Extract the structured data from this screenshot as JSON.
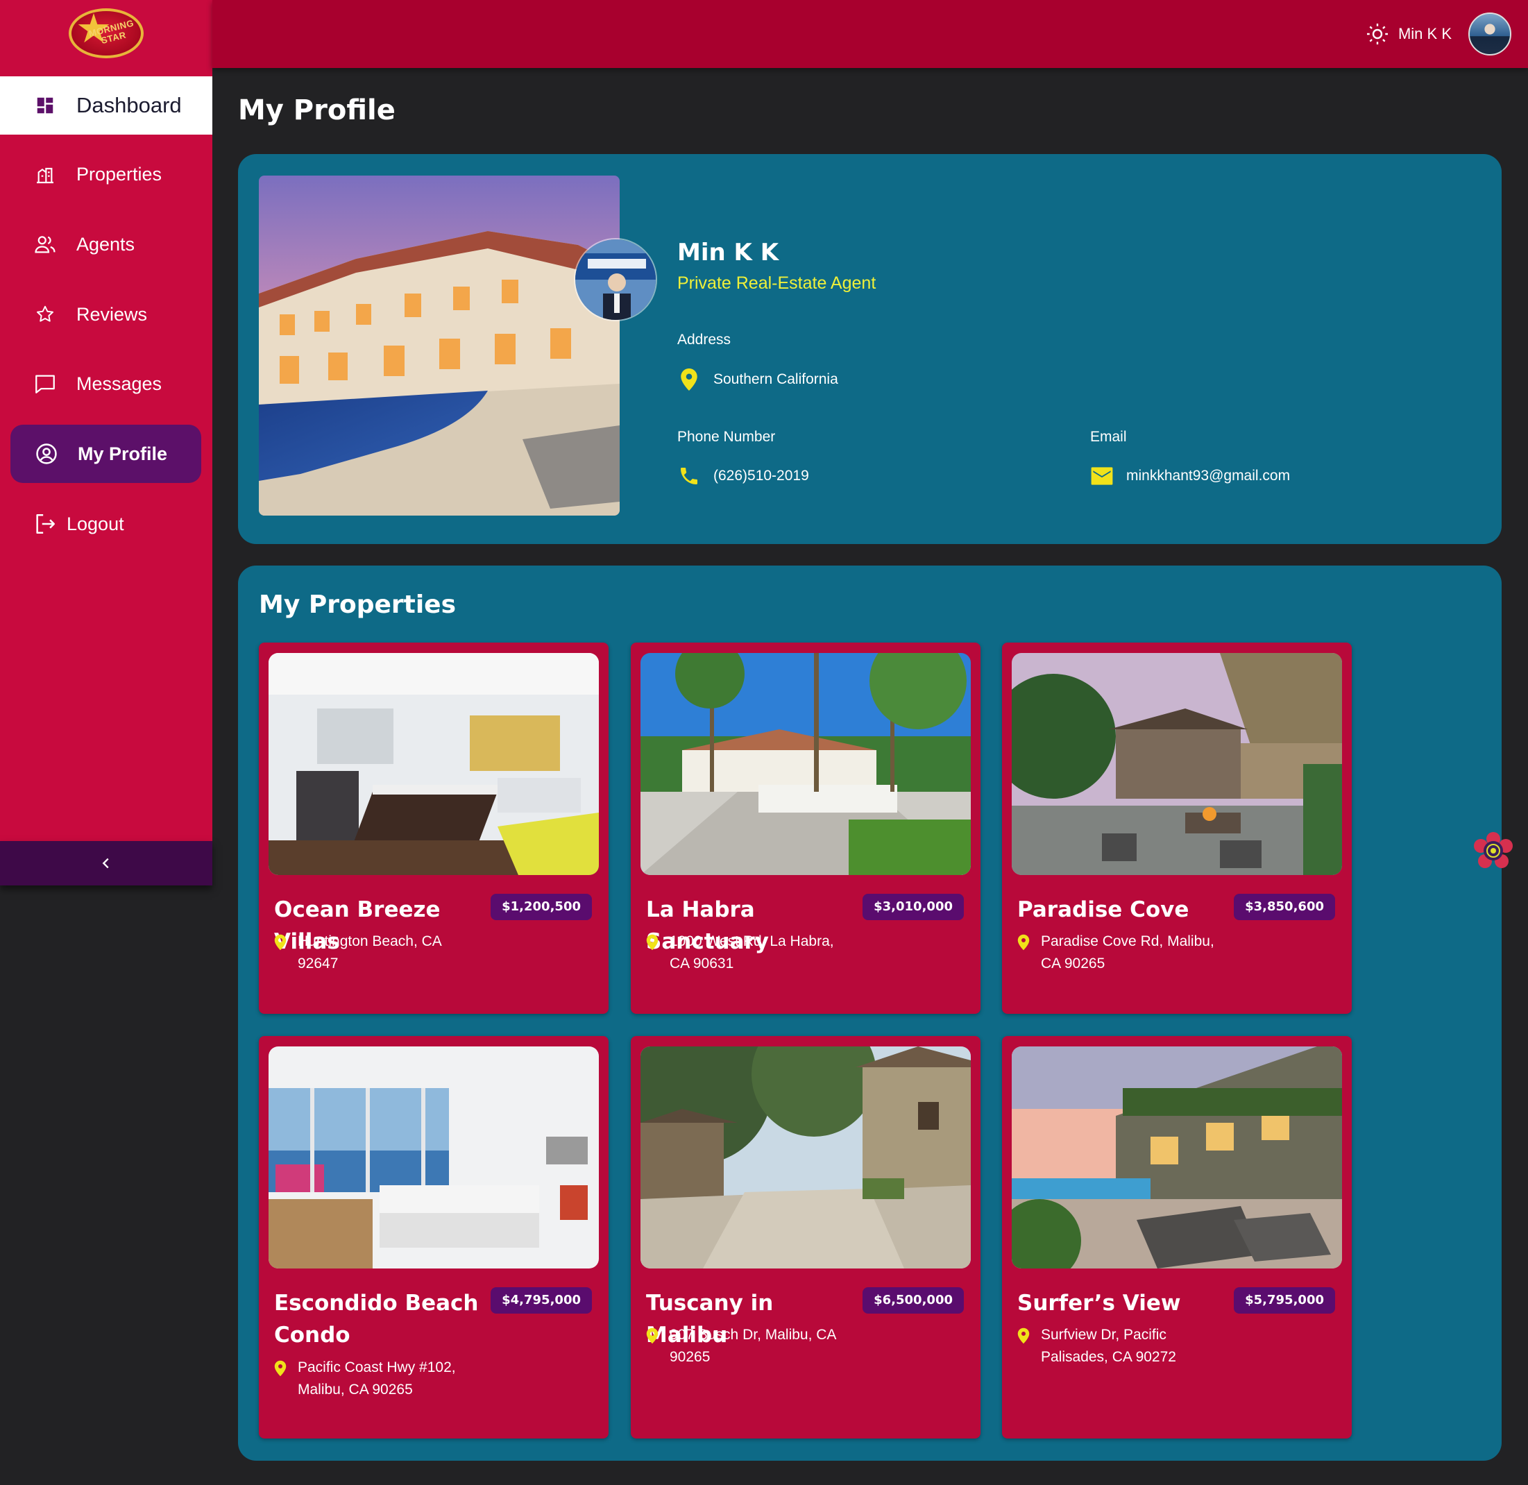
{
  "brand": {
    "logo_text_line1": "MORNING",
    "logo_text_line2": "STAR"
  },
  "sidebar": {
    "items": [
      {
        "label": "Dashboard",
        "icon": "dashboard-icon"
      },
      {
        "label": "Properties",
        "icon": "properties-icon"
      },
      {
        "label": "Agents",
        "icon": "agents-icon"
      },
      {
        "label": "Reviews",
        "icon": "star-icon"
      },
      {
        "label": "Messages",
        "icon": "message-icon"
      },
      {
        "label": "My Profile",
        "icon": "profile-icon"
      },
      {
        "label": "Logout",
        "icon": "logout-icon"
      }
    ],
    "collapse_icon": "chevron-left-icon"
  },
  "topbar": {
    "theme_icon": "sun-icon",
    "user_name": "Min K K"
  },
  "page": {
    "title": "My Profile"
  },
  "profile": {
    "name": "Min K K",
    "role": "Private Real-Estate Agent",
    "address_label": "Address",
    "address": "Southern California",
    "phone_label": "Phone Number",
    "phone": "(626)510-2019",
    "email_label": "Email",
    "email": "minkkhant93@gmail.com"
  },
  "properties": {
    "title": "My Properties",
    "items": [
      {
        "title": "Ocean Breeze Villas",
        "price": "$1,200,500",
        "address": "Huntington Beach, CA 92647"
      },
      {
        "title": "La Habra Sanctuary",
        "price": "$3,010,000",
        "address": "1000 West Rd, La Habra, CA 90631"
      },
      {
        "title": "Paradise Cove",
        "price": "$3,850,600",
        "address": "Paradise Cove Rd, Malibu, CA 90265"
      },
      {
        "title": "Escondido Beach Condo",
        "price": "$4,795,000",
        "address": "Pacific Coast Hwy #102, Malibu, CA 90265"
      },
      {
        "title": "Tuscany in Malibu",
        "price": "$6,500,000",
        "address": "007 Busch Dr, Malibu, CA 90265"
      },
      {
        "title": "Surfer’s View",
        "price": "$5,795,000",
        "address": "Surfview Dr, Pacific Palisades, CA 90272"
      }
    ]
  },
  "colors": {
    "sidebar": "#c80a3e",
    "topbar": "#a8002e",
    "card": "#0e6a87",
    "property_card": "#b8093a",
    "accent_purple": "#5c1069",
    "accent_yellow": "#eef03a"
  }
}
